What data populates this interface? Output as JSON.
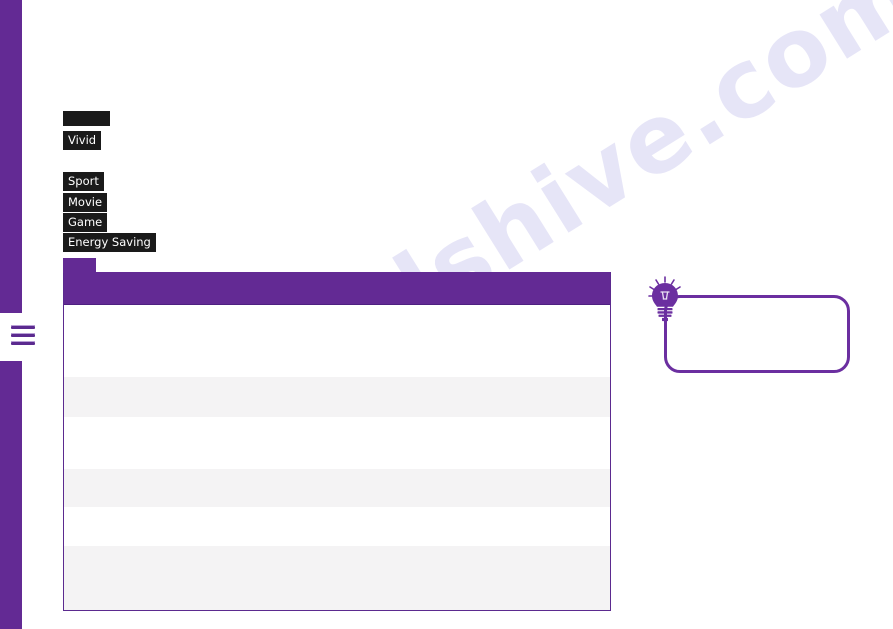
{
  "page": {
    "watermark_text": "manualshive.com",
    "background_color": "#ffffff",
    "accent_color": "#632a94",
    "label_color": "#1a1a1a",
    "stripe_color": "#f4f3f4"
  },
  "sidebar": {
    "name": "left-purple-rail",
    "color": "#632a94",
    "menu": {
      "icon": "hamburger-menu-icon",
      "label": ""
    }
  },
  "picture_modes": {
    "options": [
      {
        "id": "mode-0",
        "label": "",
        "blank": true
      },
      {
        "id": "mode-vivid",
        "label": "Vivid",
        "blank": false
      },
      {
        "id": "mode-sport",
        "label": "Sport",
        "blank": false
      },
      {
        "id": "mode-movie",
        "label": "Movie",
        "blank": false
      },
      {
        "id": "mode-game",
        "label": "Game",
        "blank": false
      },
      {
        "id": "mode-energy-saving",
        "label": "Energy Saving",
        "blank": false
      }
    ]
  },
  "spec_table": {
    "tab_label": "",
    "header": {
      "cells": [
        ""
      ]
    },
    "rows": [
      {
        "cells": [
          ""
        ],
        "alt": false
      },
      {
        "cells": [
          ""
        ],
        "alt": true
      },
      {
        "cells": [
          ""
        ],
        "alt": false
      },
      {
        "cells": [
          ""
        ],
        "alt": true
      },
      {
        "cells": [
          ""
        ],
        "alt": false
      },
      {
        "cells": [
          ""
        ],
        "alt": true
      }
    ]
  },
  "tip_callout": {
    "icon": "lightbulb-icon",
    "text": ""
  }
}
